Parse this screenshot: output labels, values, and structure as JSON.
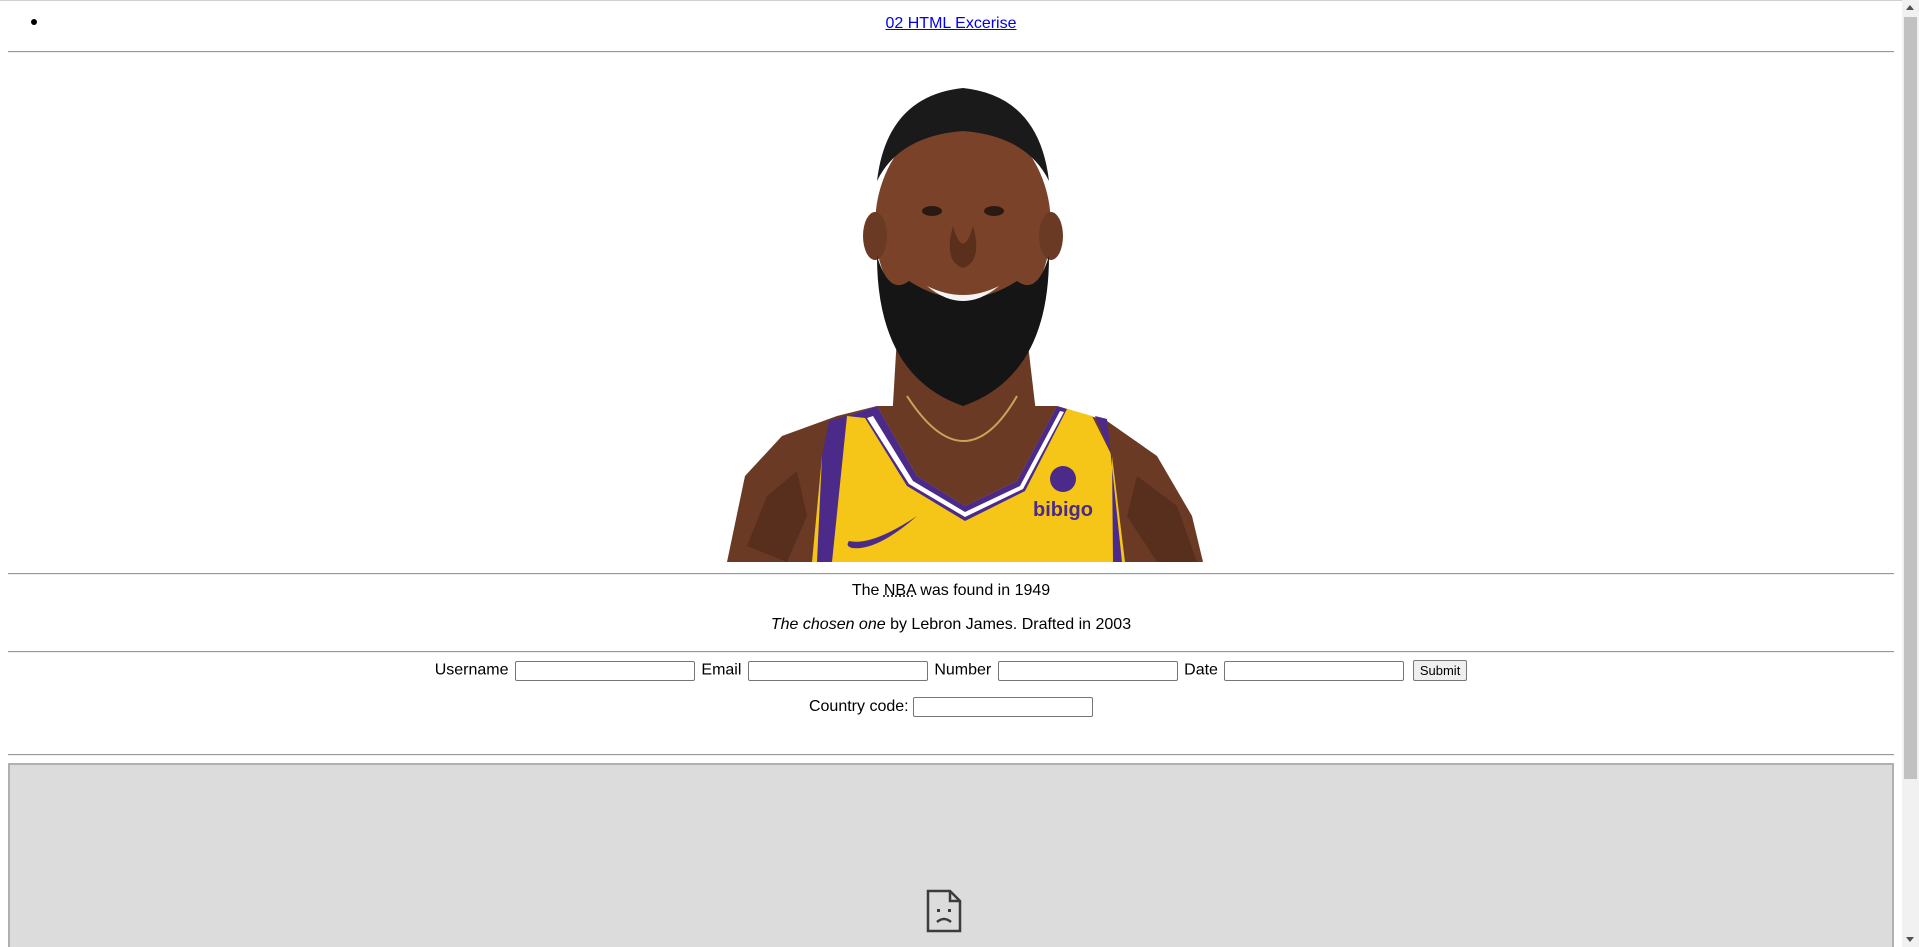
{
  "nav": {
    "link_text": "02 HTML Excerise"
  },
  "image": {
    "description_name": "lebron-james-portrait",
    "jersey_text": "bibigo"
  },
  "facts": {
    "nba_prefix": "The ",
    "nba_abbr": "NBA",
    "nba_suffix": " was found in 1949",
    "quote_italic": "The chosen one",
    "quote_rest": " by Lebron James. Drafted in 2003"
  },
  "form": {
    "username_label": "Username",
    "email_label": "Email",
    "number_label": "Number",
    "date_label": "Date",
    "submit_label": "Submit",
    "country_label": "Country code:"
  },
  "colors": {
    "link": "#0000ee",
    "jersey_yellow": "#f5c518",
    "jersey_purple": "#4b2a8a",
    "frame_bg": "#dcdcdc"
  },
  "icons": {
    "broken_frame": "sad-document-icon",
    "bullet": "list-bullet"
  }
}
